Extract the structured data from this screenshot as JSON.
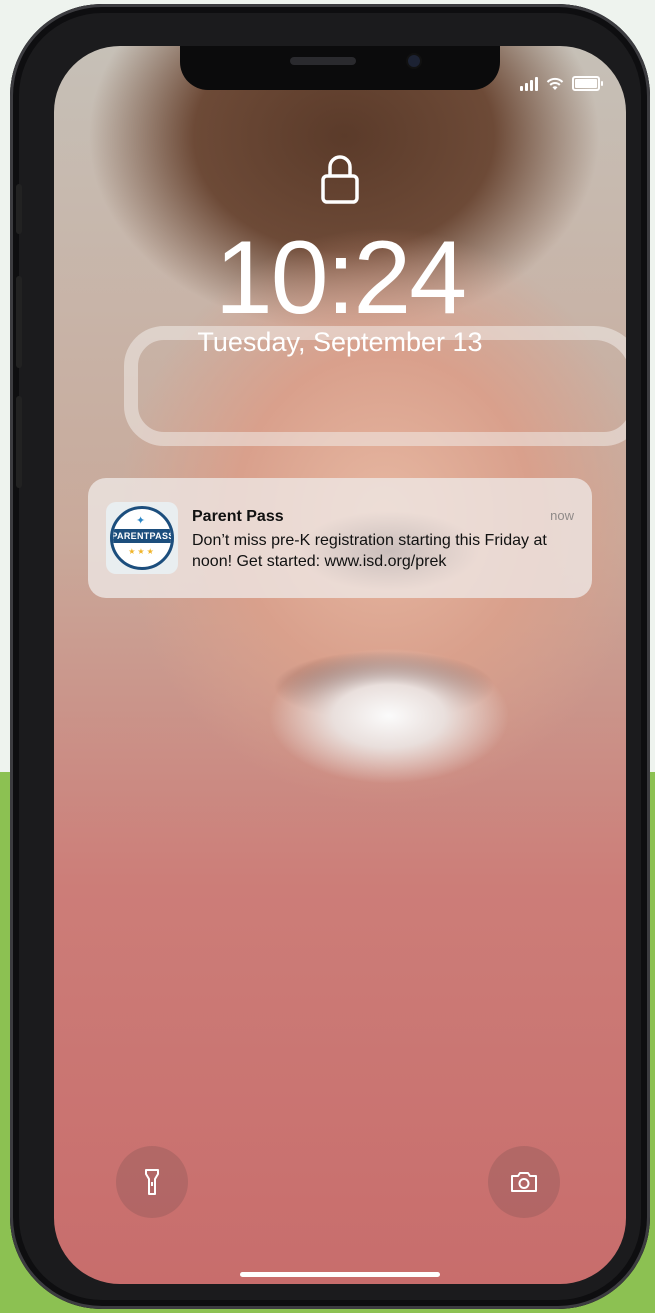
{
  "lock_screen": {
    "time": "10:24",
    "date": "Tuesday, September 13"
  },
  "status_bar": {
    "signal_icon": "cellular-signal-icon",
    "wifi_icon": "wifi-icon",
    "battery_icon": "battery-icon",
    "battery_level": 1.0
  },
  "notification": {
    "app_name": "Parent Pass",
    "time": "now",
    "message": "Don’t miss pre-K registration starting this Friday at noon! Get started: www.isd.org/prek",
    "app_icon_text": "PARENTPASS",
    "app_icon": "parent-pass-app-icon"
  },
  "quick_actions": {
    "flashlight_icon": "flashlight-icon",
    "camera_icon": "camera-icon"
  },
  "colors": {
    "background_top": "#eef3ee",
    "background_green": "#8cc152",
    "phone_frame": "#1b1b1d",
    "brand_blue": "#1c4e7d"
  }
}
